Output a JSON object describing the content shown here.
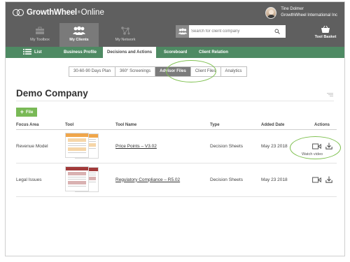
{
  "brand": {
    "name": "GrowthWheel",
    "reg": "®",
    "suffix": "Online"
  },
  "user": {
    "name": "Tine Dolmer",
    "company": "GrowthWheel International Inc"
  },
  "main_nav": [
    {
      "label": "My Toolbox",
      "icon": "toolbox-icon"
    },
    {
      "label": "My Clients",
      "icon": "clients-icon"
    },
    {
      "label": "My Network",
      "icon": "network-icon"
    }
  ],
  "search": {
    "placeholder": "Search for client company"
  },
  "tool_basket": {
    "label": "Tool Basket",
    "icon": "basket-icon"
  },
  "sub_nav": [
    {
      "label": "List",
      "icon": "list-icon"
    },
    {
      "label": "Business Profile"
    },
    {
      "label": "Decisions and Actions"
    },
    {
      "label": "Scoreboard"
    },
    {
      "label": "Client Relation"
    }
  ],
  "view_tabs": [
    "30-60-90 Days Plan",
    "360° Screenings",
    "Advisor Files",
    "Client Files",
    "Analytics"
  ],
  "active_view_tab": "Advisor Files",
  "company_name": "Demo Company",
  "add_file_label": "File",
  "table": {
    "columns": [
      "Focus Area",
      "Tool",
      "Tool Name",
      "Type",
      "Added Date",
      "Actions"
    ],
    "rows": [
      {
        "focus_area": "Revenue Model",
        "tool_name": "Price Points – V3.02",
        "type": "Decision Sheets",
        "added": "May 23 2018",
        "thumb_color": "#f0a64a"
      },
      {
        "focus_area": "Legal Issues",
        "tool_name": "Regulatory Compliance – R5.02",
        "type": "Decision Sheets",
        "added": "May 23 2018",
        "thumb_color": "#a23a3a"
      }
    ]
  },
  "tooltip": "Watch video",
  "colors": {
    "header": "#5f5f5f",
    "subnav": "#4e8a63",
    "accent_green": "#79b956",
    "highlight_ring": "#7ec04f"
  }
}
